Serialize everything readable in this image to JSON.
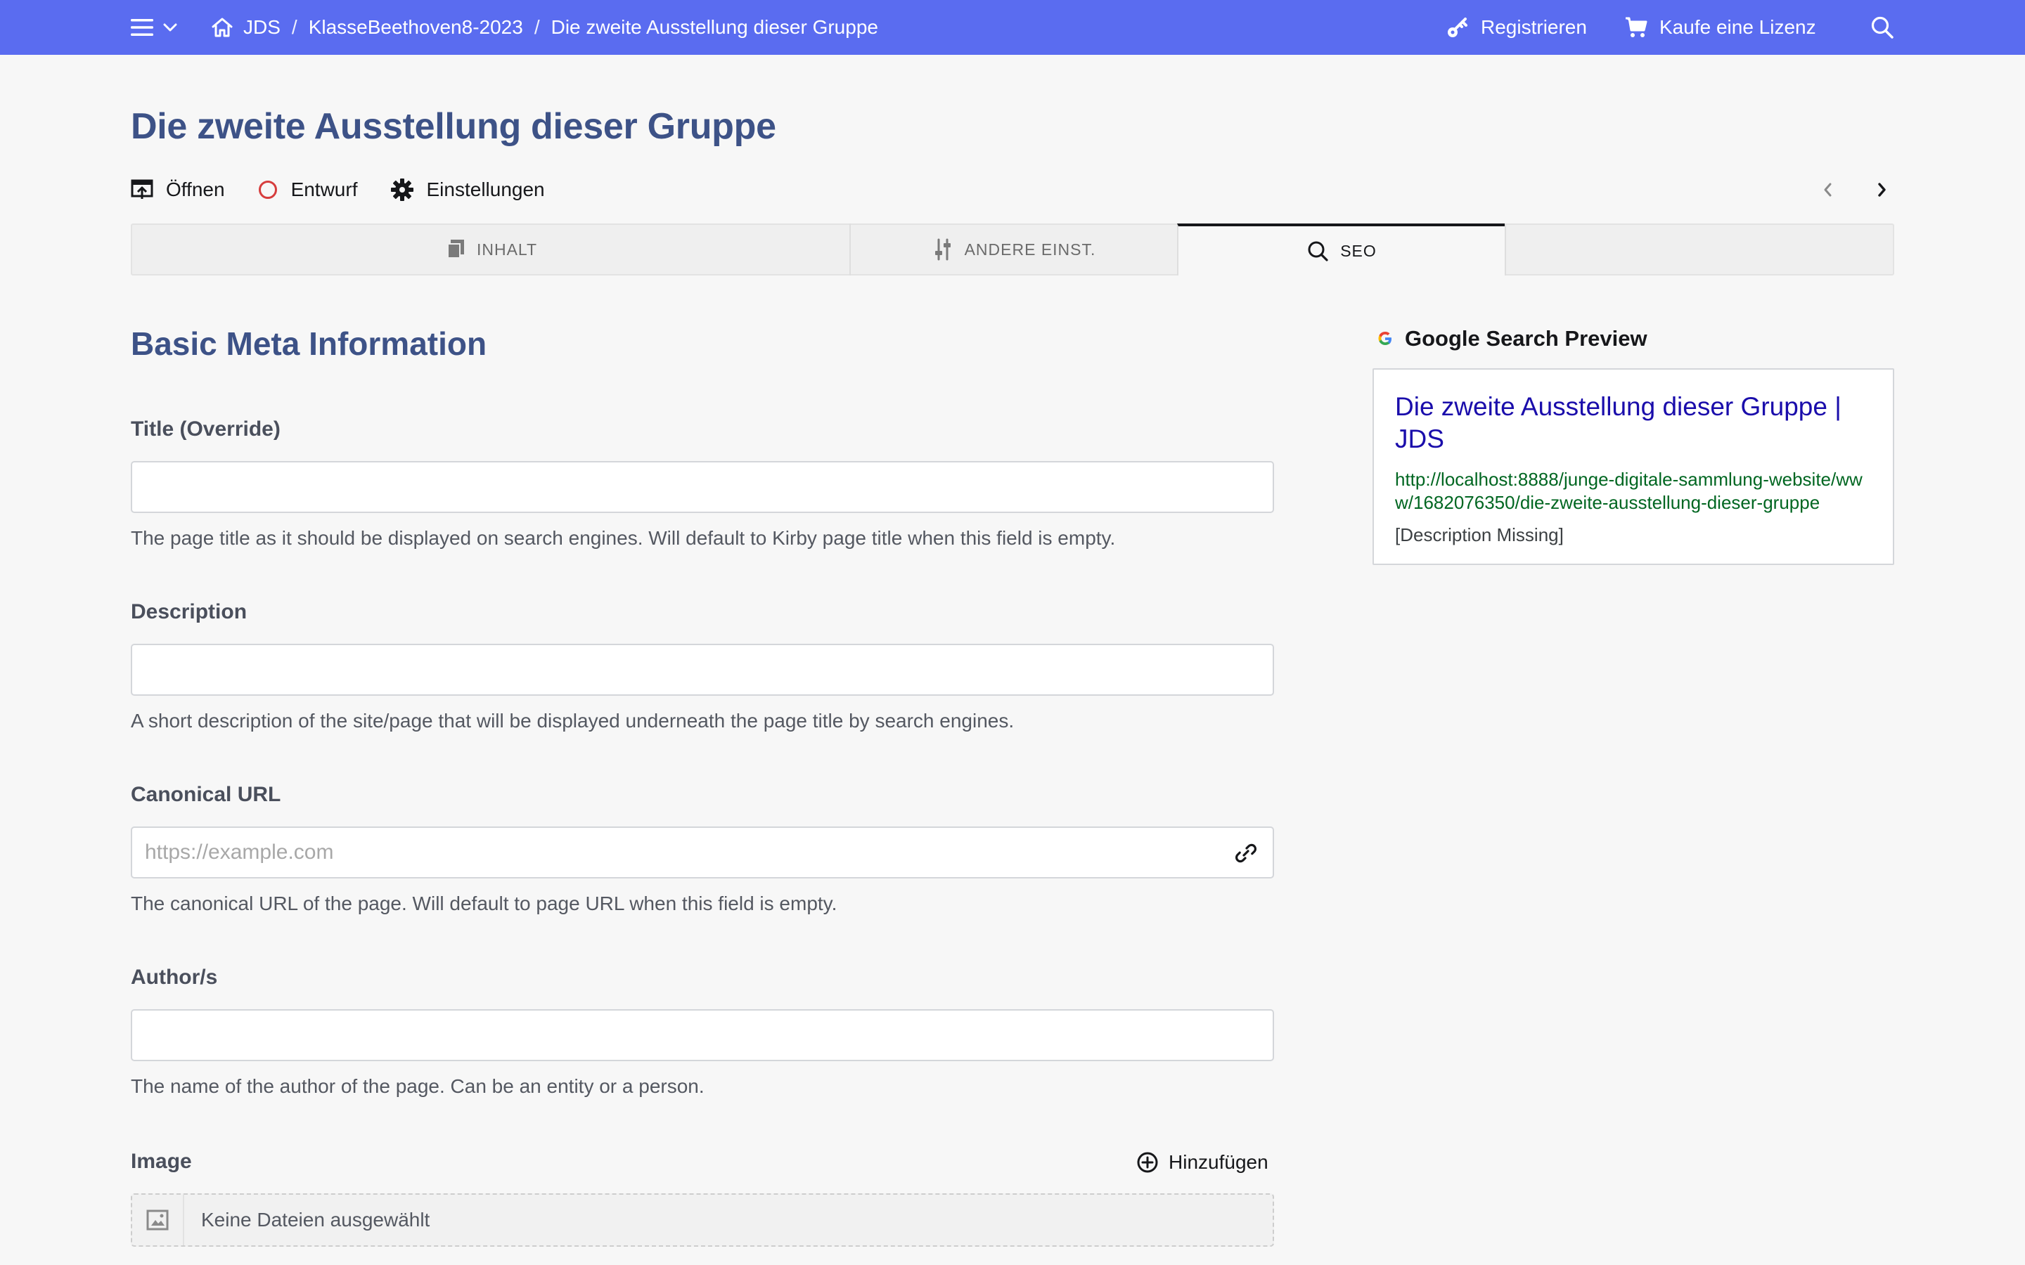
{
  "topbar": {
    "breadcrumbs": [
      "JDS",
      "KlasseBeethoven8-2023",
      "Die zweite Ausstellung dieser Gruppe"
    ],
    "register_label": "Registrieren",
    "buy_license_label": "Kaufe eine Lizenz",
    "color": "#5a6cf0"
  },
  "page": {
    "title": "Die zweite Ausstellung dieser Gruppe",
    "actions": {
      "open": "Öffnen",
      "status": "Entwurf",
      "settings": "Einstellungen"
    }
  },
  "tabs": [
    {
      "label": "INHALT",
      "icon": "pages-icon",
      "active": false
    },
    {
      "label": "ANDERE EINST.",
      "icon": "sliders-icon",
      "active": false
    },
    {
      "label": "SEO",
      "icon": "search-icon",
      "active": true
    }
  ],
  "form": {
    "section_title": "Basic Meta Information",
    "fields": {
      "title": {
        "label": "Title (Override)",
        "value": "",
        "help": "The page title as it should be displayed on search engines. Will default to Kirby page title when this field is empty."
      },
      "description": {
        "label": "Description",
        "value": "",
        "help": "A short description of the site/page that will be displayed underneath the page title by search engines."
      },
      "canonical": {
        "label": "Canonical URL",
        "value": "",
        "placeholder": "https://example.com",
        "help": "The canonical URL of the page. Will default to page URL when this field is empty."
      },
      "author": {
        "label": "Author/s",
        "value": "",
        "help": "The name of the author of the page. Can be an entity or a person."
      },
      "image": {
        "label": "Image",
        "add_label": "Hinzufügen",
        "empty_text": "Keine Dateien ausgewählt"
      }
    }
  },
  "preview": {
    "heading": "Google Search Preview",
    "title": "Die zweite Ausstellung dieser Gruppe | JDS",
    "url": "http://localhost:8888/junge-digitale-sammlung-website/www/1682076350/die-zweite-ausstellung-dieser-gruppe",
    "description": "[Description Missing]"
  }
}
